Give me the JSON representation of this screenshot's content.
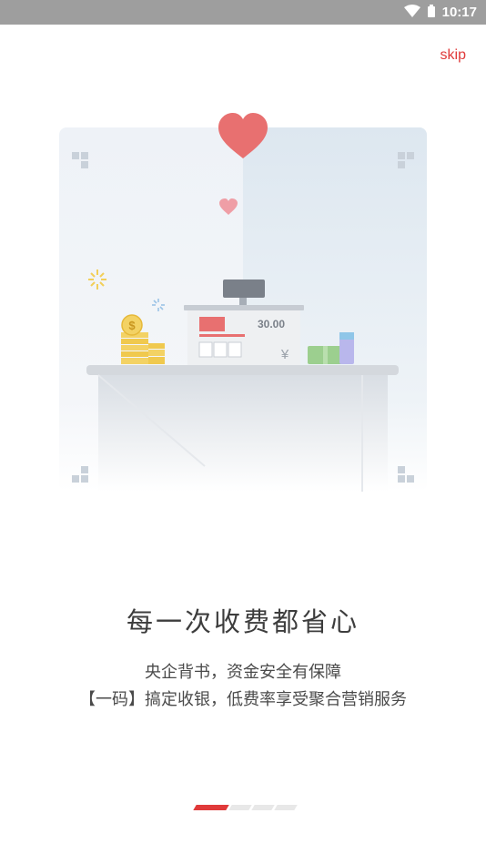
{
  "status": {
    "time": "10:17",
    "icons": [
      "wifi-icon",
      "battery-icon"
    ]
  },
  "skip_label": "skip",
  "illustration": {
    "register_amount": "30.00",
    "currency_symbol": "¥",
    "coin_symbol": "$"
  },
  "headline": "每一次收费都省心",
  "description": {
    "line1": "央企背书，资金安全有保障",
    "line2": "【一码】搞定收银，低费率享受聚合营销服务"
  },
  "indicator": {
    "total_pages": 4,
    "active_index": 0
  },
  "colors": {
    "accent": "#e03a3a",
    "heart": "#e87070",
    "status_bar": "#9e9e9e"
  }
}
